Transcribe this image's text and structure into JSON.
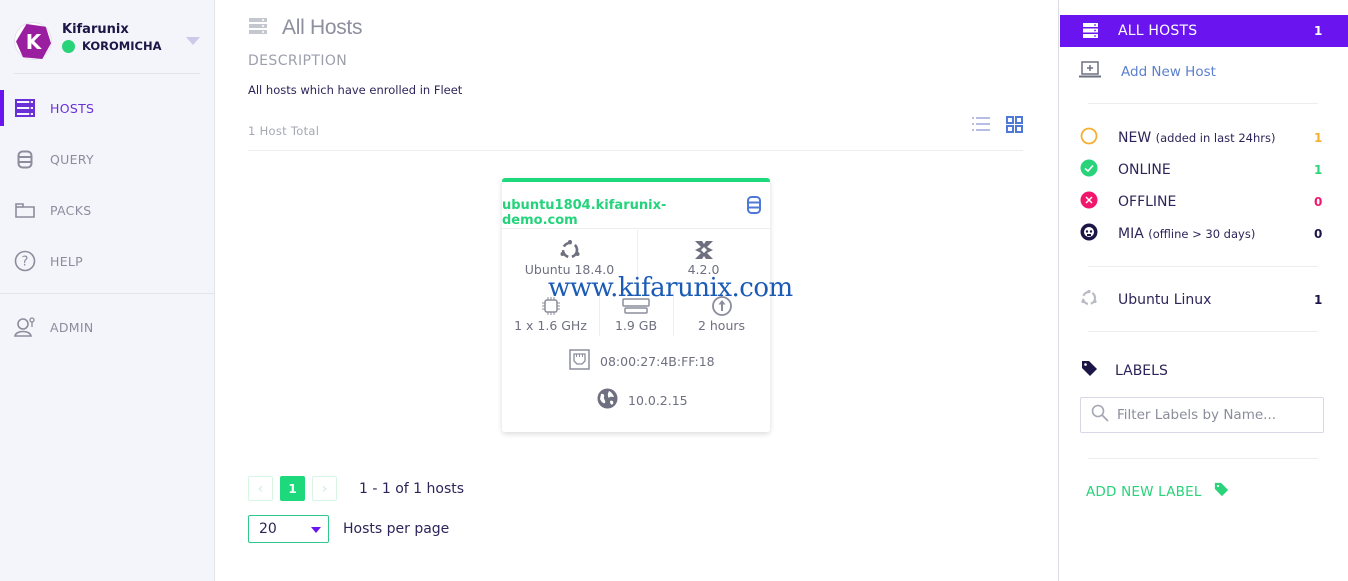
{
  "sidebar": {
    "org_name": "Kifarunix",
    "org_logo_letter": "K",
    "user_name": "KOROMICHA",
    "items": [
      {
        "label": "HOSTS",
        "icon": "hosts-icon",
        "active": true
      },
      {
        "label": "QUERY",
        "icon": "database-icon"
      },
      {
        "label": "PACKS",
        "icon": "folder-icon"
      },
      {
        "label": "HELP",
        "icon": "help-icon"
      },
      {
        "label": "ADMIN",
        "icon": "admin-icon"
      }
    ]
  },
  "main": {
    "title": "All Hosts",
    "description_heading": "DESCRIPTION",
    "description": "All hosts which have enrolled in Fleet",
    "total": "1 Host Total",
    "host_card": {
      "hostname": "ubuntu1804.kifarunix-demo.com",
      "os": "Ubuntu 18.4.0",
      "osquery_version": "4.2.0",
      "cpu": "1 x 1.6 GHz",
      "memory": "1.9 GB",
      "uptime": "2 hours",
      "mac": "08:00:27:4B:FF:18",
      "ip": "10.0.2.15"
    },
    "watermark": "www.kifarunix.com",
    "pagination": {
      "prev": "‹",
      "current_page": "1",
      "next": "›",
      "info": "1 - 1 of 1 hosts"
    },
    "per_page": {
      "value": "20",
      "label": "Hosts per page"
    }
  },
  "right_panel": {
    "all_hosts": {
      "label": "ALL HOSTS",
      "count": "1"
    },
    "add_host": "Add New Host",
    "statuses": [
      {
        "label": "NEW",
        "note": "(added in last 24hrs)",
        "count": "1",
        "color": "#f5b031"
      },
      {
        "label": "ONLINE",
        "note": "",
        "count": "1",
        "color": "#28d37a"
      },
      {
        "label": "OFFLINE",
        "note": "",
        "count": "0",
        "color": "#f1166c"
      },
      {
        "label": "MIA",
        "note": "(offline > 30 days)",
        "count": "0",
        "color": "#1c1647"
      }
    ],
    "platform": {
      "label": "Ubuntu Linux",
      "count": "1"
    },
    "labels_heading": "LABELS",
    "filter_placeholder": "Filter Labels by Name...",
    "add_label": "ADD NEW LABEL"
  },
  "colors": {
    "accent": "#6a14f0",
    "success": "#1ed87c",
    "text_dark": "#2d2559"
  }
}
